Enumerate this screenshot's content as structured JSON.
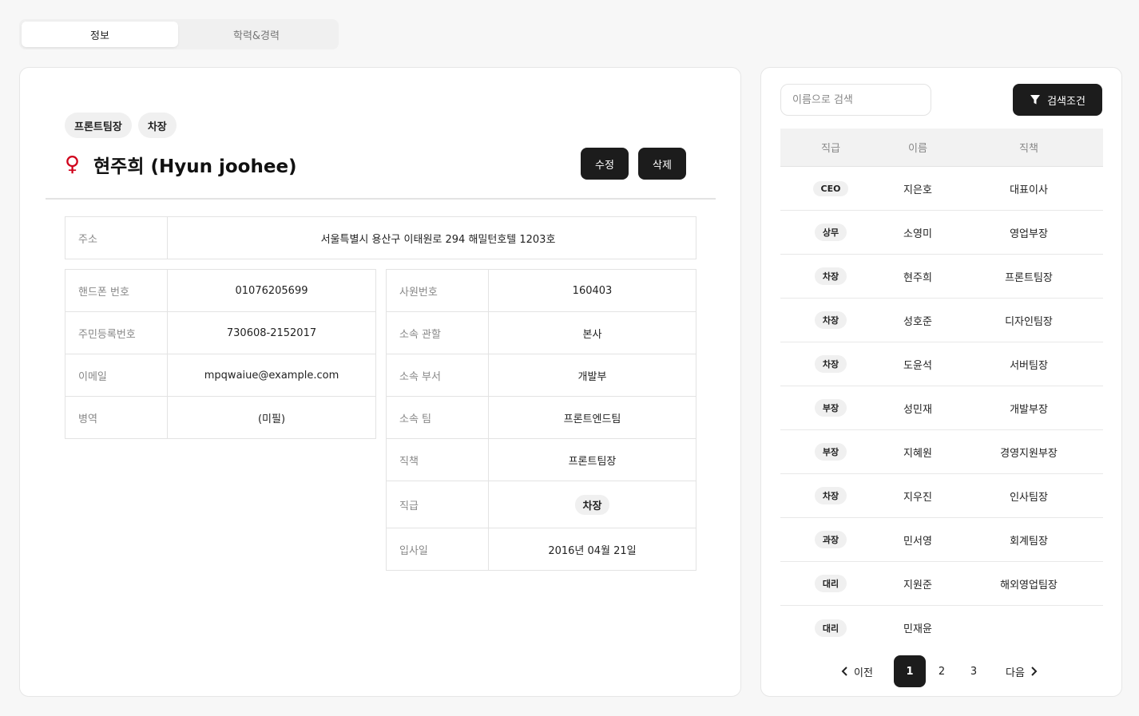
{
  "tabs": [
    {
      "label": "정보",
      "active": true
    },
    {
      "label": "학력&경력",
      "active": false
    }
  ],
  "profile": {
    "badges": [
      "프론트팀장",
      "차장"
    ],
    "gender_icon": "female-icon",
    "name": "현주희 (Hyun joohee)",
    "edit_label": "수정",
    "delete_label": "삭제"
  },
  "address": {
    "label": "주소",
    "value": "서울특별시 용산구 이태원로 294 해밀턴호텔 1203호"
  },
  "left_info": [
    {
      "label": "핸드폰 번호",
      "value": "01076205699"
    },
    {
      "label": "주민등록번호",
      "value": "730608-2152017"
    },
    {
      "label": "이메일",
      "value": "mpqwaiue@example.com"
    },
    {
      "label": "병역",
      "value": "(미필)"
    }
  ],
  "right_info": [
    {
      "label": "사원번호",
      "value": "160403"
    },
    {
      "label": "소속 관할",
      "value": "본사"
    },
    {
      "label": "소속 부서",
      "value": "개발부"
    },
    {
      "label": "소속 팀",
      "value": "프론트엔드팀"
    },
    {
      "label": "직책",
      "value": "프론트팀장"
    },
    {
      "label": "직급",
      "value": "차장"
    },
    {
      "label": "입사일",
      "value": "2016년 04월 21일"
    }
  ],
  "list": {
    "search_placeholder": "이름으로 검색",
    "filter_label": "검색조건",
    "headers": [
      "직급",
      "이름",
      "직책"
    ],
    "rows": [
      {
        "rank": "CEO",
        "name": "지은호",
        "position": "대표이사"
      },
      {
        "rank": "상무",
        "name": "소영미",
        "position": "영업부장"
      },
      {
        "rank": "차장",
        "name": "현주희",
        "position": "프론트팀장"
      },
      {
        "rank": "차장",
        "name": "성호준",
        "position": "디자인팀장"
      },
      {
        "rank": "차장",
        "name": "도윤석",
        "position": "서버팀장"
      },
      {
        "rank": "부장",
        "name": "성민재",
        "position": "개발부장"
      },
      {
        "rank": "부장",
        "name": "지혜원",
        "position": "경영지원부장"
      },
      {
        "rank": "차장",
        "name": "지우진",
        "position": "인사팀장"
      },
      {
        "rank": "과장",
        "name": "민서영",
        "position": "회계팀장"
      },
      {
        "rank": "대리",
        "name": "지원준",
        "position": "해외영업팀장"
      },
      {
        "rank": "대리",
        "name": "민재윤",
        "position": ""
      }
    ]
  },
  "pagination": {
    "prev_label": "이전",
    "next_label": "다음",
    "pages": [
      "1",
      "2",
      "3"
    ],
    "current": "1"
  }
}
